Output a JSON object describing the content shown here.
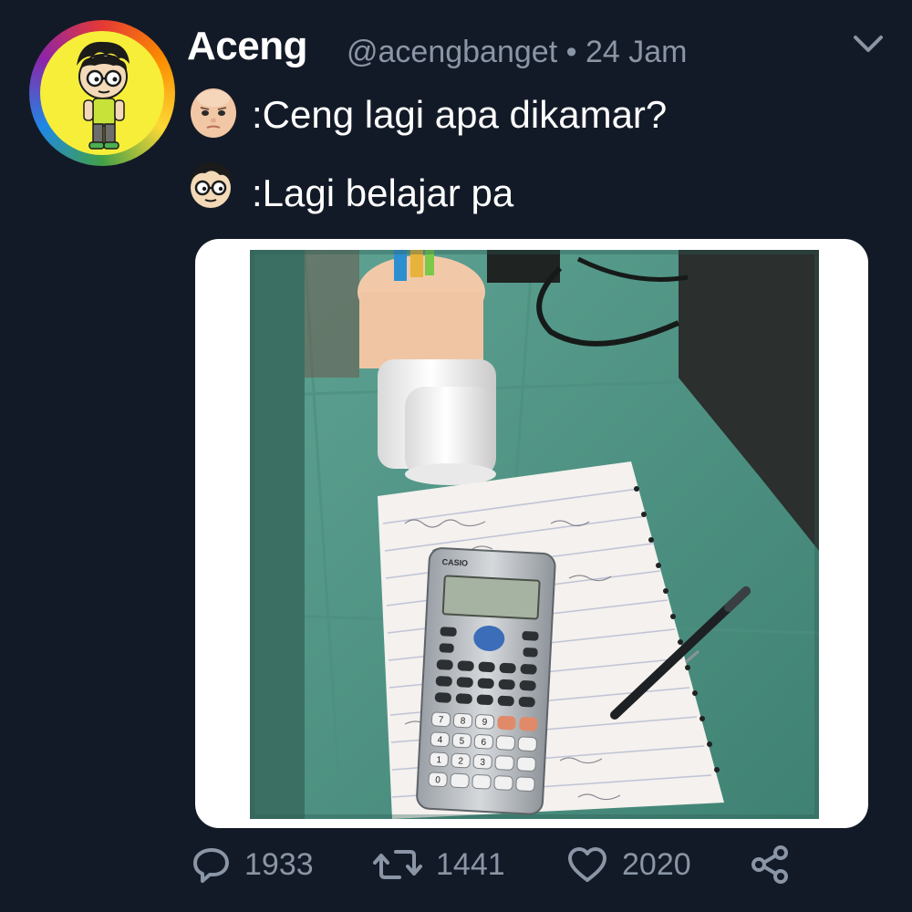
{
  "author": {
    "name": "Aceng",
    "handle": "@acengbanget",
    "separator": "•",
    "time": "24 Jam"
  },
  "dialog": [
    {
      "speaker_icon": "boss-baby-emoji-icon",
      "text": ":Ceng lagi apa dikamar?"
    },
    {
      "speaker_icon": "aceng-face-emoji-icon",
      "text": ":Lagi belajar pa"
    }
  ],
  "media": {
    "description_icon": "photo-calculator-notebook-icon",
    "calculator_brand": "CASIO",
    "calculator_keys": [
      "7",
      "8",
      "9",
      "4",
      "5",
      "6",
      "1",
      "2",
      "3",
      "0"
    ]
  },
  "actions": {
    "replies": "1933",
    "retweets": "1441",
    "likes": "2020",
    "reply_icon": "reply-icon",
    "retweet_icon": "retweet-icon",
    "like_icon": "heart-icon",
    "share_icon": "share-icon"
  },
  "colors": {
    "background": "#131a27",
    "muted_text": "#8a95a5",
    "avatar_fill": "#f7ee3a"
  }
}
